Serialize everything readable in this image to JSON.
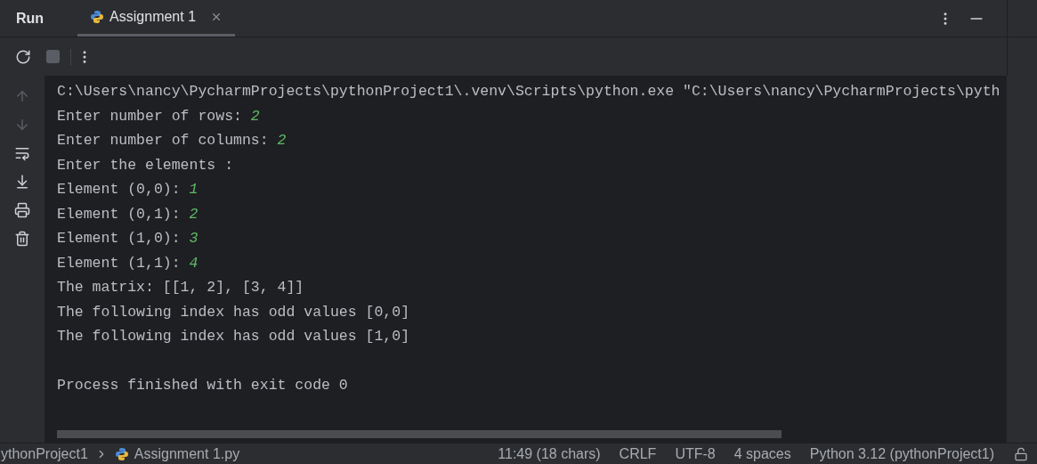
{
  "panel": {
    "title": "Run"
  },
  "tabs": [
    {
      "label": "Assignment 1",
      "selected": true
    }
  ],
  "console": {
    "lines": [
      {
        "kind": "line",
        "segments": [
          {
            "text": "C:\\Users\\nancy\\PycharmProjects\\pythonProject1\\.venv\\Scripts\\python.exe \"C:\\Users\\nancy\\PycharmProjects\\pyth",
            "input": false
          }
        ]
      },
      {
        "kind": "line",
        "segments": [
          {
            "text": "Enter number of rows: ",
            "input": false
          },
          {
            "text": "2",
            "input": true
          }
        ]
      },
      {
        "kind": "line",
        "segments": [
          {
            "text": "Enter number of columns: ",
            "input": false
          },
          {
            "text": "2",
            "input": true
          }
        ]
      },
      {
        "kind": "line",
        "segments": [
          {
            "text": "Enter the elements :",
            "input": false
          }
        ]
      },
      {
        "kind": "line",
        "segments": [
          {
            "text": "Element (0,0): ",
            "input": false
          },
          {
            "text": "1",
            "input": true
          }
        ]
      },
      {
        "kind": "line",
        "segments": [
          {
            "text": "Element (0,1): ",
            "input": false
          },
          {
            "text": "2",
            "input": true
          }
        ]
      },
      {
        "kind": "line",
        "segments": [
          {
            "text": "Element (1,0): ",
            "input": false
          },
          {
            "text": "3",
            "input": true
          }
        ]
      },
      {
        "kind": "line",
        "segments": [
          {
            "text": "Element (1,1): ",
            "input": false
          },
          {
            "text": "4",
            "input": true
          }
        ]
      },
      {
        "kind": "line",
        "segments": [
          {
            "text": "The matrix: [[1, 2], [3, 4]]",
            "input": false
          }
        ]
      },
      {
        "kind": "line",
        "segments": [
          {
            "text": "The following index has odd values [0,0]",
            "input": false
          }
        ]
      },
      {
        "kind": "line",
        "segments": [
          {
            "text": "The following index has odd values [1,0]",
            "input": false
          }
        ]
      },
      {
        "kind": "blank"
      },
      {
        "kind": "line",
        "segments": [
          {
            "text": "Process finished with exit code 0",
            "input": false
          }
        ]
      }
    ]
  },
  "status_bar": {
    "breadcrumbs": [
      "ythonProject1",
      "Assignment 1.py"
    ],
    "items": [
      "11:49 (18 chars)",
      "CRLF",
      "UTF-8",
      "4 spaces",
      "Python 3.12 (pythonProject1)"
    ]
  }
}
